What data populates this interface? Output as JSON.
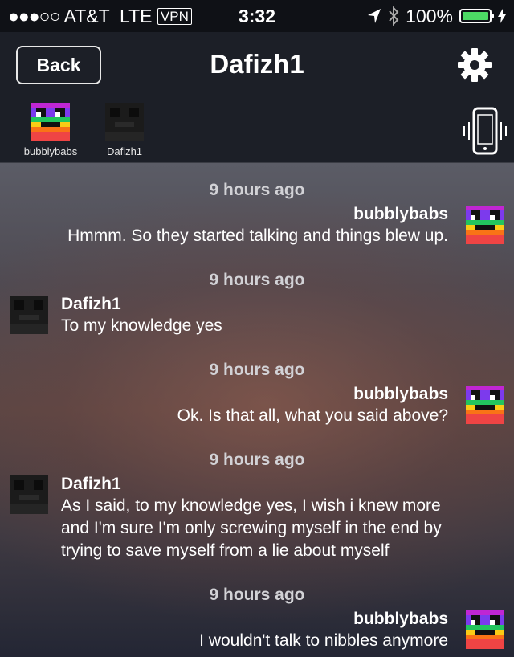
{
  "status_bar": {
    "signal": "●●●○○",
    "carrier": "AT&T",
    "network": "LTE",
    "vpn": "VPN",
    "time": "3:32",
    "battery": "100%"
  },
  "nav": {
    "back_label": "Back",
    "title": "Dafizh1",
    "participants": [
      {
        "name": "bubblybabs"
      },
      {
        "name": "Dafizh1"
      }
    ]
  },
  "colors": {
    "battery_fill": "#4cd964",
    "nav_bg": "#1c1f27"
  },
  "messages": [
    {
      "timestamp": "9 hours ago",
      "sender": "bubblybabs",
      "side": "right",
      "lines": [
        "Hmmm.  So they started talking and things blew up."
      ]
    },
    {
      "timestamp": "9 hours ago",
      "sender": "Dafizh1",
      "side": "left",
      "lines": [
        "To my knowledge yes"
      ]
    },
    {
      "timestamp": "9 hours ago",
      "sender": "bubblybabs",
      "side": "right",
      "lines": [
        "Ok.  Is that all, what you said above?"
      ]
    },
    {
      "timestamp": "9 hours ago",
      "sender": "Dafizh1",
      "side": "left",
      "lines": [
        "As I said, to my knowledge yes, I wish i knew more",
        "and I'm sure I'm only screwing myself in the end by",
        "trying to save myself from a lie about myself"
      ]
    },
    {
      "timestamp": "9 hours ago",
      "sender": "bubblybabs",
      "side": "right",
      "lines": [
        "I wouldn't talk to nibbles anymore"
      ]
    }
  ]
}
